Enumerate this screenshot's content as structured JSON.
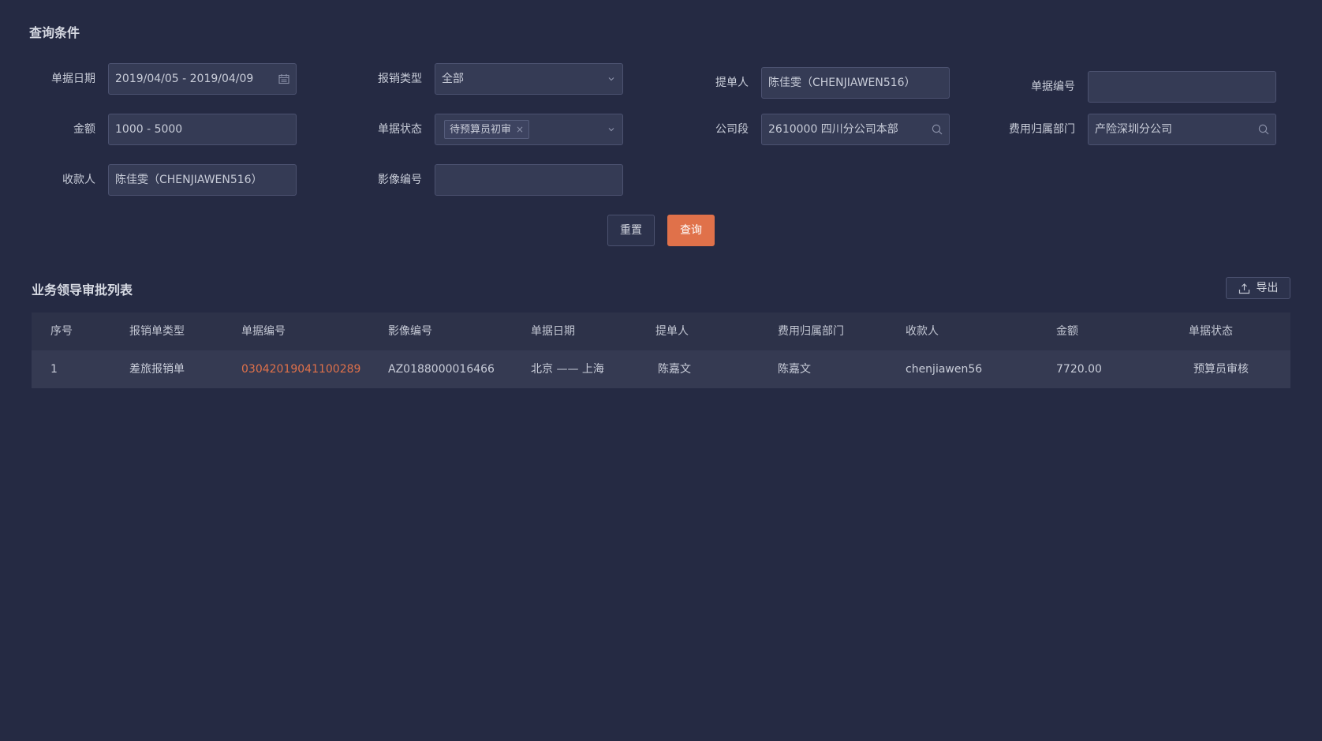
{
  "query_section": {
    "title": "查询条件",
    "fields": {
      "doc_date": {
        "label": "单据日期",
        "value": "2019/04/05 - 2019/04/09",
        "icon": "calendar-icon"
      },
      "expense_type": {
        "label": "报销类型",
        "value": "全部",
        "icon": "chevron-down-icon"
      },
      "submitter": {
        "label": "提单人",
        "value": "陈佳雯（CHENJIAWEN516）"
      },
      "doc_number": {
        "label": "单据编号",
        "value": ""
      },
      "amount": {
        "label": "金额",
        "value": "1000 - 5000"
      },
      "doc_status": {
        "label": "单据状态",
        "tag": "待预算员初审",
        "tag_close": "×",
        "icon": "chevron-down-icon"
      },
      "company": {
        "label": "公司段",
        "value": "2610000 四川分公司本部",
        "icon": "search-icon"
      },
      "cost_dept": {
        "label": "费用归属部门",
        "value": "产险深圳分公司",
        "icon": "search-icon"
      },
      "payee": {
        "label": "收款人",
        "value": "陈佳雯（CHENJIAWEN516）"
      },
      "image_number": {
        "label": "影像编号",
        "value": ""
      }
    },
    "buttons": {
      "reset": "重置",
      "query": "查询"
    }
  },
  "list_section": {
    "title": "业务领导审批列表",
    "export_label": "导出",
    "export_icon": "upload-icon",
    "columns": [
      "序号",
      "报销单类型",
      "单据编号",
      "影像编号",
      "单据日期",
      "提单人",
      "费用归属部门",
      "收款人",
      "金额",
      "单据状态"
    ],
    "rows": [
      [
        "1",
        "差旅报销单",
        "03042019041100289",
        "AZ0188000016466",
        "北京 —— 上海",
        "陈嘉文",
        "陈嘉文",
        "chenjiawen56",
        "7720.00",
        "预算员审核"
      ]
    ]
  },
  "colors": {
    "background": "#252a43",
    "accent": "#e0714a",
    "input_bg": "#353b55",
    "table_header_bg": "#2d3249",
    "table_row_bg": "#353a52"
  }
}
